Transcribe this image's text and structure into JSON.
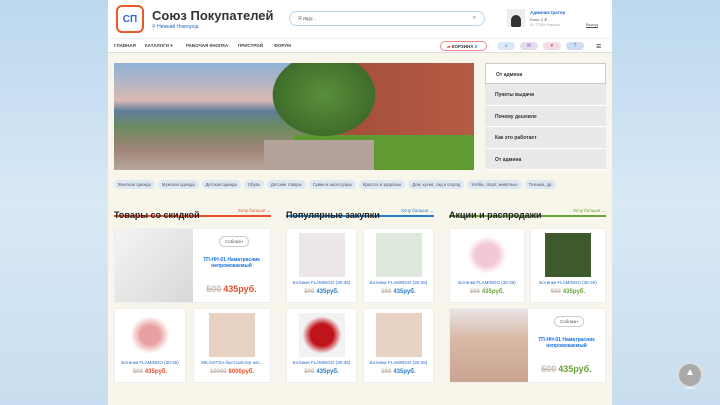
{
  "header": {
    "brand": "Союз Покупателей",
    "city": "Нижний Новгород",
    "logo_text": "СП",
    "search_placeholder": "Я ищу...",
    "user": {
      "name": "Администратор",
      "balance": "Банк: 0 ₽",
      "id": "ID: 27358 Новичок"
    },
    "exit": "Выход"
  },
  "nav": {
    "items": [
      "ГЛАВНАЯ",
      "КАТАЛОГИ ▾",
      "РАБОЧАЯ КНОПКА",
      "ПРИСТРОЙ",
      "ФОРУМ"
    ],
    "cart_label": "КОРЗИНА",
    "cart_count": "2"
  },
  "side_menu": [
    "От админа",
    "Пункты выдачи",
    "Почему дешевле",
    "Как это работает",
    "От админа"
  ],
  "categories": [
    "Женская одежда",
    "Мужская одежда",
    "Детская одежда",
    "Обувь",
    "Детские товары",
    "Сумки и аксессуары",
    "Красота и здоровье",
    "Дом, кухня, сад и огород",
    "Хобби, спорт, животные",
    "Техника, др."
  ],
  "sections": [
    {
      "title": "Товары со скидкой",
      "more": "Хочу больше →",
      "color": "#e8502a"
    },
    {
      "title": "Популярные закупки",
      "more": "Хочу больше →",
      "color": "#2a7bc4"
    },
    {
      "title": "Акции и распродажи",
      "more": "Хочу больше →",
      "color": "#6aa33a"
    }
  ],
  "products": {
    "wide1": {
      "tag": "Соблазн",
      "name": "ТП-НН-01 Наматрасник непромокаемый",
      "old": "500",
      "price": "435руб."
    },
    "d1": {
      "name": "Ботинки FLAMINGO (30-36)",
      "old": "500",
      "price": "435руб."
    },
    "d2": {
      "name": "MILAVITSA бюстгальтер нат...",
      "old": "10000",
      "price": "8000руб."
    },
    "p1": {
      "name": "Ботинки FLAMINGO (30-36)",
      "old": "500",
      "price": "435руб."
    },
    "p2": {
      "name": "Ботинки FLAMINGO (30-36)",
      "old": "500",
      "price": "435руб."
    },
    "p3": {
      "name": "Ботинки FLAMINGO (30-36)",
      "old": "500",
      "price": "435руб."
    },
    "p4": {
      "name": "Ботинки FLAMINGO (30-36)",
      "old": "500",
      "price": "435руб."
    },
    "a1": {
      "name": "Ботинки FLAMINGO (30-36)",
      "old": "500",
      "price": "435руб."
    },
    "a2": {
      "name": "Ботинки FLAMINGO (30-36)",
      "old": "500",
      "price": "435руб."
    },
    "wide2": {
      "tag": "Соблазн",
      "name": "ТП-НН-01 Наматрасник непромокаемый",
      "old": "500",
      "price": "435руб."
    }
  },
  "totop_label": "НАВЕРХ"
}
